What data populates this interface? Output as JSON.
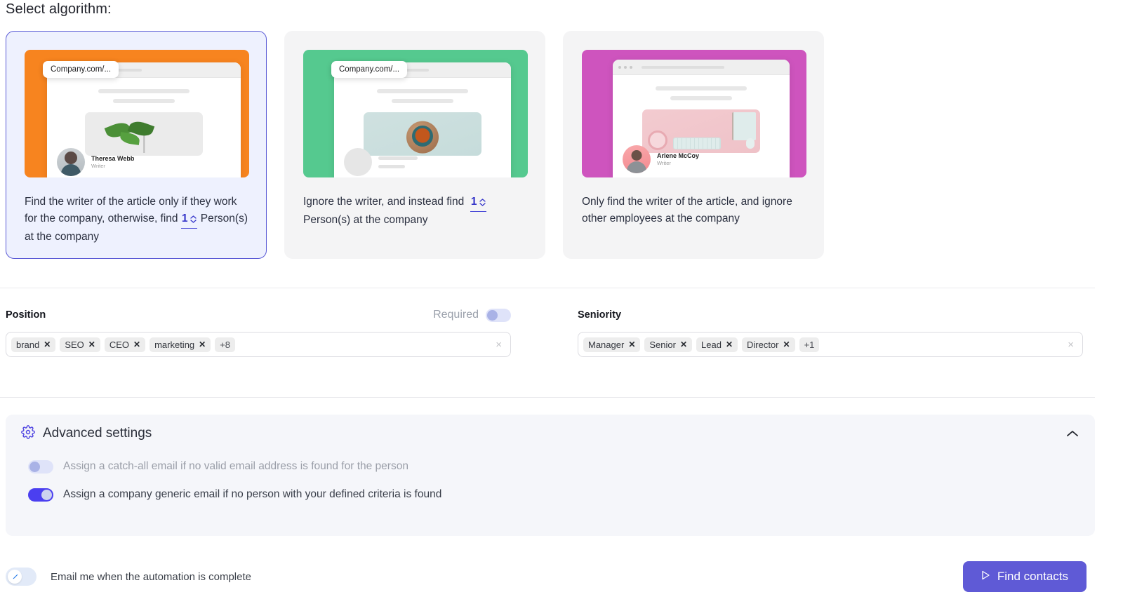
{
  "heading": "Select algorithm:",
  "algorithms": [
    {
      "url_pill": "Company.com/...",
      "author_name": "Theresa Webb",
      "author_role": "Writer",
      "desc_before": "Find the writer of the article only if they work for the company, otherwise, find",
      "count": "1",
      "desc_after": "Person(s) at the company",
      "selected": true,
      "color": "#f7841f"
    },
    {
      "url_pill": "Company.com/...",
      "author_name": "",
      "author_role": "",
      "desc_before": "Ignore the writer, and instead find",
      "count": "1",
      "desc_after": "Person(s) at the company",
      "selected": false,
      "color": "#55c98f"
    },
    {
      "url_pill": "",
      "author_name": "Arlene McCoy",
      "author_role": "Writer",
      "desc_before": "Only find the writer of the article, and ignore other employees at the company",
      "count": "",
      "desc_after": "",
      "selected": false,
      "color": "#ce54be"
    }
  ],
  "position": {
    "label": "Position",
    "required_label": "Required",
    "required_on": false,
    "chips": [
      "brand",
      "SEO",
      "CEO",
      "marketing"
    ],
    "overflow": "+8",
    "clear": "×"
  },
  "seniority": {
    "label": "Seniority",
    "chips": [
      "Manager",
      "Senior",
      "Lead",
      "Director"
    ],
    "overflow": "+1",
    "clear": "×"
  },
  "advanced": {
    "title": "Advanced settings",
    "expanded": true,
    "options": [
      {
        "label": "Assign a catch-all email if no valid email address is found for the person",
        "on": false
      },
      {
        "label": "Assign a company generic email if no person with your defined criteria is found",
        "on": true
      }
    ]
  },
  "footer": {
    "email_label": "Email me when the automation is complete",
    "email_on": false,
    "find_button": "Find contacts"
  },
  "colors": {
    "accent": "#5f5ad6",
    "accent_strong": "#4b3ff0",
    "selected_card_bg": "#eef1fe",
    "selected_card_border": "#5b5bd6",
    "panel_bg": "#f5f6fa",
    "card_bg": "#f4f4f5",
    "chip_bg": "#ededed"
  }
}
